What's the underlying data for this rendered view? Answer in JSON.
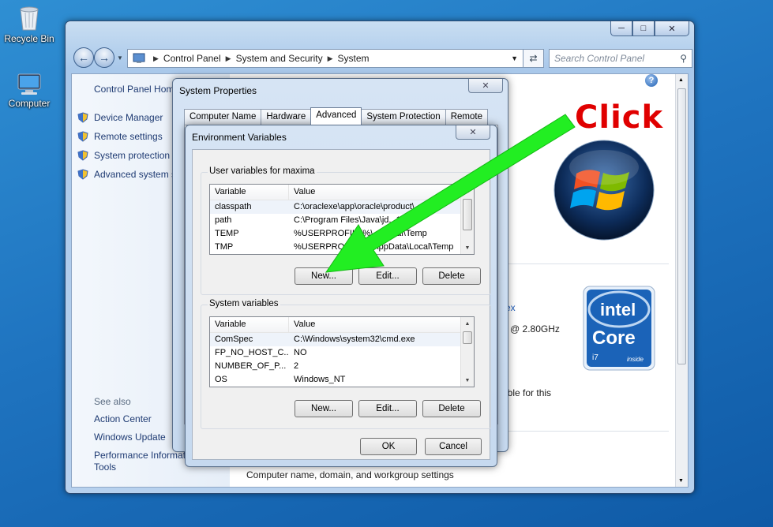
{
  "desktop": {
    "recycle_bin": "Recycle Bin",
    "computer": "Computer"
  },
  "explorer": {
    "address": [
      "Control Panel",
      "System and Security",
      "System"
    ],
    "search_placeholder": "Search Control Panel",
    "left_pane": {
      "home": "Control Panel Hom",
      "items": [
        "Device Manager",
        "Remote settings",
        "System protection",
        "Advanced system s"
      ],
      "see_also": "See also",
      "see_also_items": [
        "Action Center",
        "Windows Update",
        "Performance Informat",
        "Tools"
      ]
    },
    "main": {
      "clock_speed": "@ 2.80GHz",
      "partial_avail": "able for this",
      "partial_ex": "ex",
      "computer_name_heading": "Computer name, domain, and workgroup settings"
    }
  },
  "system_properties": {
    "title": "System Properties",
    "tabs": [
      "Computer Name",
      "Hardware",
      "Advanced",
      "System Protection",
      "Remote"
    ],
    "active_tab": "Advanced",
    "ok": "OK",
    "cancel": "Cancel"
  },
  "env_vars": {
    "title": "Environment Variables",
    "user_group": "User variables for maxima",
    "system_group": "System variables",
    "col_variable": "Variable",
    "col_value": "Value",
    "user_rows": [
      {
        "variable": "classpath",
        "value": "C:\\oraclexe\\app\\oracle\\product\\...\\..."
      },
      {
        "variable": "path",
        "value": "C:\\Program Files\\Java\\jd...1\\bin"
      },
      {
        "variable": "TEMP",
        "value": "%USERPROFILE%\\...\\Local\\Temp"
      },
      {
        "variable": "TMP",
        "value": "%USERPROFILE%\\AppData\\Local\\Temp"
      }
    ],
    "system_rows": [
      {
        "variable": "ComSpec",
        "value": "C:\\Windows\\system32\\cmd.exe"
      },
      {
        "variable": "FP_NO_HOST_C...",
        "value": "NO"
      },
      {
        "variable": "NUMBER_OF_P...",
        "value": "2"
      },
      {
        "variable": "OS",
        "value": "Windows_NT"
      }
    ],
    "new": "New...",
    "edit": "Edit...",
    "delete": "Delete"
  },
  "annotation": {
    "text": "Click",
    "color": "#e00000",
    "arrow_color": "#22ee22"
  },
  "intel": {
    "brand": "intel",
    "product": "Core",
    "model": "i7",
    "tag": "inside"
  }
}
